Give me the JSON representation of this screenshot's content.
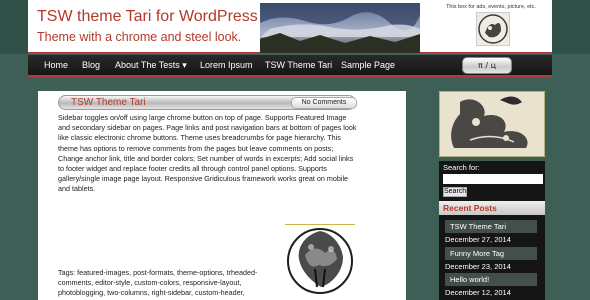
{
  "header": {
    "site_title": "TSW theme Tari for WordPress",
    "site_description": "Theme with a chrome and steel look.",
    "ad_text": "This box for ads, events, picture, etc."
  },
  "nav": {
    "items": [
      "Home",
      "Blog",
      "About The Tests ▾",
      "Lorem Ipsum",
      "TSW Theme Tari",
      "Sample Page"
    ],
    "toggle_label": "π / ц"
  },
  "post": {
    "title": "TSW Theme Tari",
    "comments_label": "No Comments",
    "body": "Sidebar toggles on/off using large chrome button on top of page. Supports Featured Image and secondary sidebar on pages. Page links and post navigation bars at bottom of pages look like classic electronic chrome buttons. Theme uses breadcrumbs for page hierarchy. This theme has options to remove comments from the pages but leave comments on posts; Change anchor link, title and border colors; Set number of words in excerpts; Add social links to footer widget and replace footer credits all through control panel options. Supports gallery/single image page layout. Responsive Gridiculous framework works great on mobile and tablets.",
    "tags": "Tags: featured-images, post-formats, theme-options, trheaded-comments, editor-style, custom-colors, responsive-layout, photoblogging, two-columns, right-sidebar, custom-header,"
  },
  "sidebar": {
    "search_label": "Search for:",
    "search_button": "Search",
    "recent_title": "Recent Posts",
    "recent_posts": [
      {
        "title": "TSW Theme Tari",
        "date": "December 27, 2014"
      },
      {
        "title": "Funny More Tag",
        "date": "December 23, 2014"
      },
      {
        "title": "Hello world!",
        "date": "December 12, 2014"
      }
    ]
  },
  "colors": {
    "background": "#3d5f56",
    "title_red": "#b23a2a",
    "nav_black": "#151515"
  }
}
